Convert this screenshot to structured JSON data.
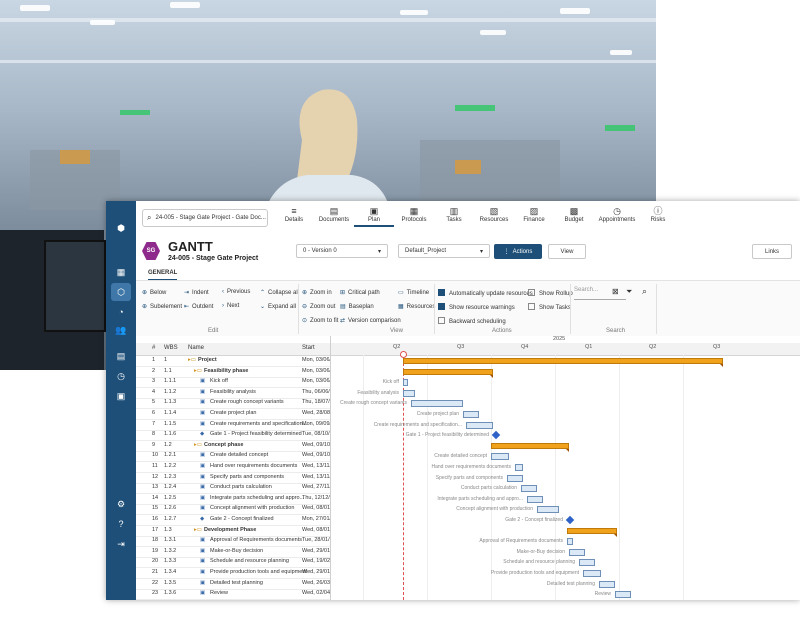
{
  "app": {
    "search_text": "24-005 - Stage Gate Project - Gate Doc...",
    "badge": "SG",
    "title": "GANTT",
    "subtitle": "24-005 - Stage Gate Project",
    "version_dropdown": "0 - Version 0",
    "project_dropdown": "Default_Project",
    "actions_label": "Actions",
    "view_label": "View",
    "links_label": "Links",
    "tab_general": "GENERAL"
  },
  "nav": [
    {
      "label": "Details",
      "icon": "≡"
    },
    {
      "label": "Documents",
      "icon": "▤"
    },
    {
      "label": "Plan",
      "icon": "▣"
    },
    {
      "label": "Protocols",
      "icon": "▦"
    },
    {
      "label": "Tasks",
      "icon": "▥"
    },
    {
      "label": "Resources",
      "icon": "▧"
    },
    {
      "label": "Finance",
      "icon": "▨"
    },
    {
      "label": "Budget",
      "icon": "▩"
    },
    {
      "label": "Appointments",
      "icon": "◷"
    },
    {
      "label": "Risks",
      "icon": "ⓘ"
    }
  ],
  "ribbon": {
    "edit": {
      "below": "Below",
      "indent": "Indent",
      "previous": "Previous",
      "collapse_all": "Collapse all",
      "subelement": "Subelement",
      "outdent": "Outdent",
      "next": "Next",
      "expand_all": "Expand all",
      "label": "Edit"
    },
    "view": {
      "zoom_in": "Zoom in",
      "critical_path": "Critical path",
      "timeline": "Timeline",
      "zoom_out": "Zoom out",
      "baseplan": "Baseplan",
      "resources": "Resources",
      "zoom_fit": "Zoom to fit",
      "version_comparison": "Version comparison",
      "label": "View"
    },
    "actions": {
      "auto_update": "Automatically update resources",
      "show_warnings": "Show resource warnings",
      "backward": "Backward scheduling",
      "show_rollup": "Show Rollup",
      "show_tasks": "Show Tasks",
      "label": "Actions"
    },
    "search": {
      "placeholder": "Search...",
      "label": "Search"
    }
  },
  "grid": {
    "headers": {
      "num": "#",
      "wbs": "WBS",
      "name": "Name",
      "start": "Start"
    },
    "year": "2025",
    "quarters": [
      "Q2",
      "Q3",
      "Q4",
      "Q1",
      "Q2",
      "Q3"
    ],
    "rows": [
      {
        "n": "1",
        "wbs": "1",
        "name": "Project",
        "start": "Mon, 03/06/",
        "type": "summary"
      },
      {
        "n": "2",
        "wbs": "1.1",
        "name": "Feasibility phase",
        "start": "Mon, 03/06/",
        "type": "summary"
      },
      {
        "n": "3",
        "wbs": "1.1.1",
        "name": "Kick off",
        "start": "Mon, 03/06/",
        "type": "task"
      },
      {
        "n": "4",
        "wbs": "1.1.2",
        "name": "Feasibility analysis",
        "start": "Thu, 06/06/",
        "type": "task"
      },
      {
        "n": "5",
        "wbs": "1.1.3",
        "name": "Create rough concept variants",
        "start": "Thu, 18/07/",
        "type": "task"
      },
      {
        "n": "6",
        "wbs": "1.1.4",
        "name": "Create project plan",
        "start": "Wed, 28/08/",
        "type": "task"
      },
      {
        "n": "7",
        "wbs": "1.1.5",
        "name": "Create requirements and specification...",
        "start": "Mon, 09/09/",
        "type": "task"
      },
      {
        "n": "8",
        "wbs": "1.1.6",
        "name": "Gate 1 - Project feasibility determined",
        "start": "Tue, 08/10/",
        "type": "milestone"
      },
      {
        "n": "9",
        "wbs": "1.2",
        "name": "Concept phase",
        "start": "Wed, 09/10/",
        "type": "summary"
      },
      {
        "n": "10",
        "wbs": "1.2.1",
        "name": "Create detailed concept",
        "start": "Wed, 09/10/",
        "type": "task"
      },
      {
        "n": "11",
        "wbs": "1.2.2",
        "name": "Hand over requirements documents",
        "start": "Wed, 13/11/",
        "type": "task"
      },
      {
        "n": "12",
        "wbs": "1.2.3",
        "name": "Specify parts and components",
        "start": "Wed, 13/11/",
        "type": "task"
      },
      {
        "n": "13",
        "wbs": "1.2.4",
        "name": "Conduct parts calculation",
        "start": "Wed, 27/11/",
        "type": "task"
      },
      {
        "n": "14",
        "wbs": "1.2.5",
        "name": "Integrate parts scheduling and appro...",
        "start": "Thu, 12/12/",
        "type": "task"
      },
      {
        "n": "15",
        "wbs": "1.2.6",
        "name": "Concept alignment with production",
        "start": "Wed, 08/01/",
        "type": "task"
      },
      {
        "n": "16",
        "wbs": "1.2.7",
        "name": "Gate 2 - Concept finalized",
        "start": "Mon, 27/01/",
        "type": "milestone"
      },
      {
        "n": "17",
        "wbs": "1.3",
        "name": "Development Phase",
        "start": "Wed, 08/01/",
        "type": "summary"
      },
      {
        "n": "18",
        "wbs": "1.3.1",
        "name": "Approval of Requirements documents",
        "start": "Tue, 28/01/",
        "type": "task"
      },
      {
        "n": "19",
        "wbs": "1.3.2",
        "name": "Make-or-Buy decision",
        "start": "Wed, 29/01/",
        "type": "task"
      },
      {
        "n": "20",
        "wbs": "1.3.3",
        "name": "Schedule and resource planning",
        "start": "Wed, 19/02/",
        "type": "task"
      },
      {
        "n": "21",
        "wbs": "1.3.4",
        "name": "Provide production tools and equipment",
        "start": "Wed, 29/01/",
        "type": "task"
      },
      {
        "n": "22",
        "wbs": "1.3.5",
        "name": "Detailed test planning",
        "start": "Wed, 26/03/",
        "type": "task"
      },
      {
        "n": "23",
        "wbs": "1.3.6",
        "name": "Review",
        "start": "Wed, 02/04/",
        "type": "task"
      }
    ]
  }
}
